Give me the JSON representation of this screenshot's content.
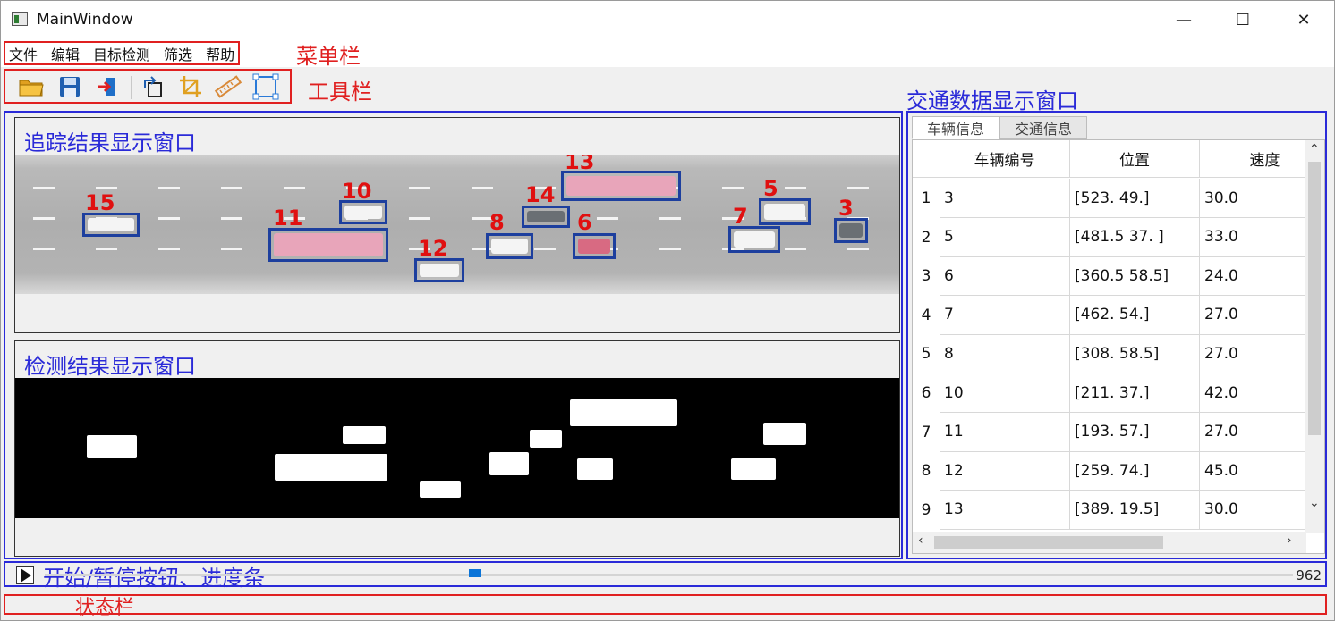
{
  "window": {
    "title": "MainWindow",
    "minimize": "—",
    "maximize": "☐",
    "close": "✕"
  },
  "menu": {
    "items": [
      "文件",
      "编辑",
      "目标检测",
      "筛选",
      "帮助"
    ]
  },
  "annotations": {
    "menubar": "菜单栏",
    "toolbar": "工具栏",
    "traffic_window": "交通数据显示窗口",
    "tracking_window": "追踪结果显示窗口",
    "detection_window": "检测结果显示窗口",
    "controls": "开始/暂停按钮、进度条",
    "statusbar": "状态栏"
  },
  "toolbar": {
    "buttons": [
      "folder-open-icon",
      "save-icon",
      "exit-icon",
      "rotate-icon",
      "crop-icon",
      "ruler-icon",
      "select-region-icon"
    ]
  },
  "tracking": {
    "labels": [
      "15",
      "10",
      "11",
      "12",
      "8",
      "14",
      "13",
      "6",
      "7",
      "5",
      "3"
    ]
  },
  "tabs": [
    "车辆信息",
    "交通信息"
  ],
  "table": {
    "columns": [
      "车辆编号",
      "位置",
      "速度"
    ],
    "rows": [
      {
        "n": "1",
        "id": "3",
        "pos": "[523.  49.]",
        "speed": "30.0"
      },
      {
        "n": "2",
        "id": "5",
        "pos": "[481.5  37. ]",
        "speed": "33.0"
      },
      {
        "n": "3",
        "id": "6",
        "pos": "[360.5  58.5]",
        "speed": "24.0"
      },
      {
        "n": "4",
        "id": "7",
        "pos": "[462.  54.]",
        "speed": "27.0"
      },
      {
        "n": "5",
        "id": "8",
        "pos": "[308.   58.5]",
        "speed": "27.0"
      },
      {
        "n": "6",
        "id": "10",
        "pos": "[211.  37.]",
        "speed": "42.0"
      },
      {
        "n": "7",
        "id": "11",
        "pos": "[193.  57.]",
        "speed": "27.0"
      },
      {
        "n": "8",
        "id": "12",
        "pos": "[259.  74.]",
        "speed": "45.0"
      },
      {
        "n": "9",
        "id": "13",
        "pos": "[389.   19.5]",
        "speed": "30.0"
      }
    ]
  },
  "progress": {
    "total_frames": "962",
    "fraction": 0.34
  },
  "colors": {
    "annotation_red": "#e02020",
    "annotation_blue": "#2a2ad8",
    "bbox": "#1d3f9e",
    "slider": "#0a74d8"
  }
}
